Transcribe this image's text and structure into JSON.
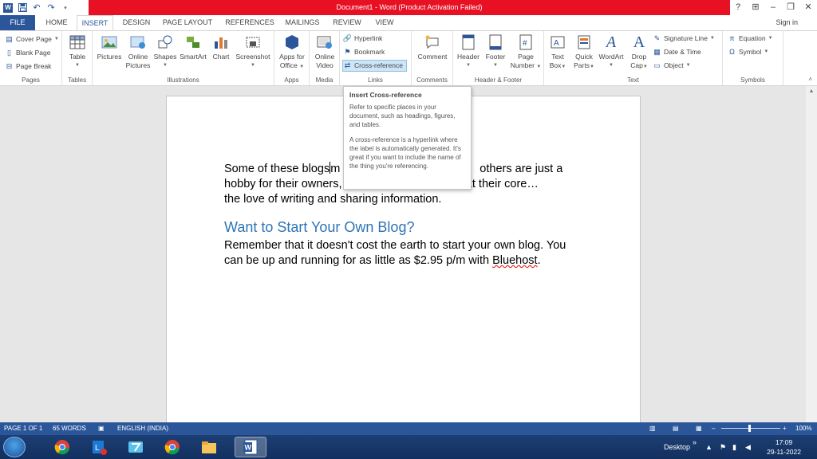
{
  "window": {
    "title": "Document1 - Word (Product Activation Failed)",
    "controls": [
      "?",
      "⊞",
      "–",
      "❐",
      "✕"
    ]
  },
  "colors": {
    "accent": "#2b579a",
    "title_bar": "#e81123",
    "heading": "#2e74b5"
  },
  "tabs": [
    {
      "label": "FILE"
    },
    {
      "label": "HOME"
    },
    {
      "label": "INSERT"
    },
    {
      "label": "DESIGN"
    },
    {
      "label": "PAGE LAYOUT"
    },
    {
      "label": "REFERENCES"
    },
    {
      "label": "MAILINGS"
    },
    {
      "label": "REVIEW"
    },
    {
      "label": "VIEW"
    }
  ],
  "signin": "Sign in",
  "ribbon": {
    "pages": {
      "label": "Pages",
      "cover_page": "Cover Page",
      "blank_page": "Blank Page",
      "page_break": "Page Break"
    },
    "tables": {
      "label": "Tables",
      "table": "Table"
    },
    "illustrations": {
      "label": "Illustrations",
      "pictures": "Pictures",
      "online_pictures_1": "Online",
      "online_pictures_2": "Pictures",
      "shapes": "Shapes",
      "smartart": "SmartArt",
      "chart": "Chart",
      "screenshot": "Screenshot"
    },
    "apps": {
      "label": "Apps",
      "apps_1": "Apps for",
      "apps_2": "Office"
    },
    "media": {
      "label": "Media",
      "video_1": "Online",
      "video_2": "Video"
    },
    "links": {
      "label": "Links",
      "hyperlink": "Hyperlink",
      "bookmark": "Bookmark",
      "cross_reference": "Cross-reference"
    },
    "comments": {
      "label": "Comments",
      "comment": "Comment"
    },
    "header_footer": {
      "label": "Header & Footer",
      "header": "Header",
      "footer": "Footer",
      "page_number_1": "Page",
      "page_number_2": "Number"
    },
    "text": {
      "label": "Text",
      "text_box_1": "Text",
      "text_box_2": "Box",
      "quick_parts_1": "Quick",
      "quick_parts_2": "Parts",
      "wordart": "WordArt",
      "drop_cap_1": "Drop",
      "drop_cap_2": "Cap",
      "signature_line": "Signature Line",
      "date_time": "Date & Time",
      "object": "Object"
    },
    "symbols": {
      "label": "Symbols",
      "equation": "Equation",
      "symbol": "Symbol"
    }
  },
  "tooltip": {
    "title": "Insert Cross-reference",
    "para1": "Refer to specific places in your document, such as headings, figures, and tables.",
    "para2": "A cross-reference is a hyperlink where the label is automatically generated. It's great if you want to include the name of the thing you're referencing."
  },
  "document": {
    "para1_line1_a": "Some of these blogs",
    "para1_line1_b": "m",
    "para1_line1_c": "others are just a",
    "para1_line2_a": "hobby for their owners,",
    "para1_line2_c": "rpose at their core…",
    "para1_line3": "the love of writing and sharing information.",
    "heading": "Want to Start Your Own Blog?",
    "para2": "Remember that it doesn't cost the earth to start your own blog. You can be up and running for as little as $2.95 p/m with ",
    "para2_link": "Bluehost",
    "para2_end": "."
  },
  "status": {
    "page": "PAGE 1 OF 1",
    "words": "65 WORDS",
    "language": "ENGLISH (INDIA)",
    "zoom": "100%",
    "zoom_minus": "–",
    "zoom_plus": "+"
  },
  "taskbar": {
    "desktop": "Desktop",
    "time": "17:09",
    "date": "29-11-2022"
  }
}
